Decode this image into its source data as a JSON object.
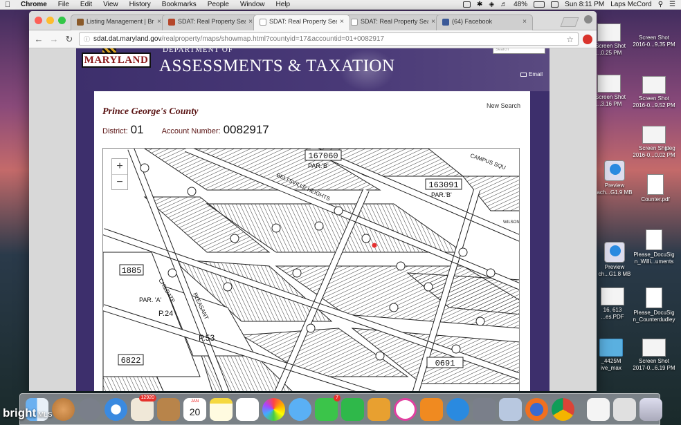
{
  "menubar": {
    "app": "Chrome",
    "items": [
      "File",
      "Edit",
      "View",
      "History",
      "Bookmarks",
      "People",
      "Window",
      "Help"
    ],
    "battery": "48%",
    "clock": "Sun 8:11 PM",
    "user": "Laps McCord"
  },
  "browser": {
    "tabs": [
      {
        "label": "Listing Management | Brig",
        "favicon_color": "#8a5a2a",
        "active": false
      },
      {
        "label": "SDAT: Real Property Searc",
        "favicon_color": "#b5462a",
        "active": false
      },
      {
        "label": "SDAT: Real Property Searc",
        "favicon_color": "#ffffff",
        "active": true
      },
      {
        "label": "SDAT: Real Property Searc",
        "favicon_color": "#ffffff",
        "active": false
      },
      {
        "label": "(64) Facebook",
        "favicon_color": "#3b5998",
        "active": false
      }
    ],
    "url_host": "sdat.dat.maryland.gov",
    "url_path": "/realproperty/maps/showmap.html?countyid=17&accountid=01+0082917"
  },
  "site": {
    "logo_text": "MARYLAND",
    "dept_line1": "DEPARTMENT OF",
    "dept_title": "ASSESSMENTS & TAXATION",
    "search_placeholder": "Search",
    "email_label": "Email",
    "county": "Prince George's County",
    "new_search": "New Search",
    "district_label": "District:",
    "district_value": "01",
    "account_label": "Account Number:",
    "account_value": "0082917"
  },
  "map": {
    "zoom_in": "+",
    "zoom_out": "−",
    "labels": [
      "167060",
      "PAR.'B'",
      "163091",
      "PAR.'B'",
      "1885",
      "6822",
      "0691",
      "P.24",
      "P.53",
      "PAR. 'A'",
      "BELTSVILLE HEIGHTS",
      "CAMPUS SQU",
      "CHILDATE",
      "PLEASANT",
      "WILSON"
    ],
    "marker_color": "#e53030"
  },
  "desktop": {
    "icons": [
      {
        "label": "Screen Shot",
        "sub": "...0.25 PM"
      },
      {
        "label": "Screen Shot",
        "sub": "2016-0...9.35 PM"
      },
      {
        "label": "Screen Shot",
        "sub": "...3.16 PM"
      },
      {
        "label": "Screen Shot",
        "sub": "2016-0...9.52 PM"
      },
      {
        "label": "Screen Shot",
        "sub": "2016-0...0.02 PM"
      },
      {
        "label": ".jpeg",
        "sub": ""
      },
      {
        "label": "Preview",
        "sub": "ach...G1.9 MB"
      },
      {
        "label": "Counter.pdf",
        "sub": ""
      },
      {
        "label": "Preview",
        "sub": "ch...G1.8 MB"
      },
      {
        "label": "Please_DocuSig",
        "sub": "n_Willi...uments"
      },
      {
        "label": "16, 613",
        "sub": "...es.PDF"
      },
      {
        "label": "Please_DocuSig",
        "sub": "n_Counterdudley"
      },
      {
        "label": "_4425M",
        "sub": "ive_max"
      },
      {
        "label": "Screen Shot",
        "sub": "2017-0...6.19 PM"
      }
    ]
  },
  "dock": {
    "calendar_month": "JAN",
    "calendar_day": "20",
    "photos_badge": "12920",
    "messages_badge": "7",
    "watermark_brand": "bright",
    "watermark_suffix": "MLS"
  }
}
